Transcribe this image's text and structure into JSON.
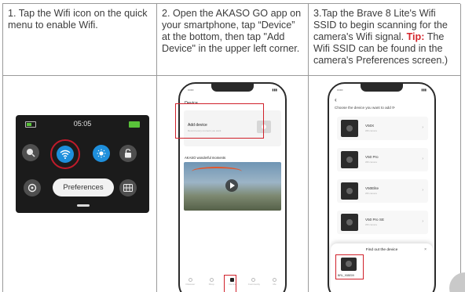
{
  "steps": [
    {
      "text": "1. Tap the Wifi icon on the quick menu to enable Wifi."
    },
    {
      "text": "2. Open the AKASO GO app on your smartphone, tap “Device” at the bottom, then tap \"Add Device\" in the upper left corner."
    },
    {
      "text_before": "3.Tap the Brave 8 Lite's Wifi SSID to begin scanning for the camera's Wifi signal. ",
      "tip_label": "Tip:",
      "text_after": " The Wifi SSID can be found in the camera's Preferences screen.)"
    }
  ],
  "camera_screen": {
    "time": "05:05",
    "preferences_label": "Preferences"
  },
  "phone_device": {
    "title": "Device",
    "add_device": "Add device",
    "add_device_sub": "Record every moment you want",
    "section": "AKASO wonderful moments",
    "nav": [
      "Discover",
      "Shop",
      "Device",
      "Community",
      "Me"
    ]
  },
  "phone_add": {
    "back": "‹",
    "choose": "Choose the device you want to add ⟳",
    "devices": [
      {
        "name": "V50X",
        "sub": "Wifi camera"
      },
      {
        "name": "V50 Pro",
        "sub": "Wifi camera"
      },
      {
        "name": "V50Elite",
        "sub": "Wifi camera"
      },
      {
        "name": "V50 Pro SE",
        "sub": "Wifi camera"
      }
    ],
    "find_title": "Find out the device",
    "close": "×",
    "found_ssid": "BRL_908E09"
  },
  "colors": {
    "accent_red": "#d0202a",
    "wifi_blue": "#1e8fdc",
    "battery_green": "#59c23a"
  }
}
